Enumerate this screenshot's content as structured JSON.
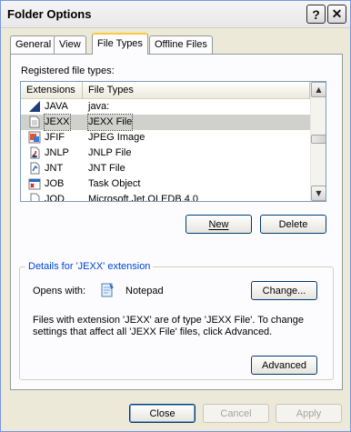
{
  "window": {
    "title": "Folder Options",
    "help_glyph": "?",
    "close_glyph": "✕"
  },
  "tabs": [
    {
      "label": "General",
      "active": false
    },
    {
      "label": "View",
      "active": false
    },
    {
      "label": "File Types",
      "active": true
    },
    {
      "label": "Offline Files",
      "active": false
    }
  ],
  "file_types": {
    "registered_label": "Registered file types:",
    "columns": [
      "Extensions",
      "File Types"
    ],
    "rows": [
      {
        "ext": "JAVA",
        "type": "java:",
        "icon": "java-file-icon",
        "selected": false
      },
      {
        "ext": "JEXX",
        "type": "JEXX File",
        "icon": "generic-file-icon",
        "selected": true
      },
      {
        "ext": "JFIF",
        "type": "JPEG Image",
        "icon": "image-file-icon",
        "selected": false
      },
      {
        "ext": "JNLP",
        "type": "JNLP File",
        "icon": "java-webstart-icon",
        "selected": false
      },
      {
        "ext": "JNT",
        "type": "JNT File",
        "icon": "journal-file-icon",
        "selected": false
      },
      {
        "ext": "JOB",
        "type": "Task Object",
        "icon": "task-object-icon",
        "selected": false
      },
      {
        "ext": "JOD",
        "type": "Microsoft.Jet.OLEDB.4.0",
        "icon": "database-file-icon",
        "selected": false
      }
    ],
    "new_label": "New",
    "delete_label": "Delete"
  },
  "details": {
    "legend": "Details for 'JEXX' extension",
    "opens_with_label": "Opens with:",
    "opens_with_app": "Notepad",
    "change_label": "Change...",
    "description_line1": "Files with extension 'JEXX' are of type 'JEXX File'.  To change",
    "description_line2": "settings that affect all 'JEXX File' files, click Advanced.",
    "advanced_label": "Advanced"
  },
  "footer": {
    "close_label": "Close",
    "cancel_label": "Cancel",
    "apply_label": "Apply"
  },
  "colors": {
    "selection": "#d0d0cc",
    "group_legend": "#0046d5",
    "active_tab_accent": "#ffc83c"
  }
}
